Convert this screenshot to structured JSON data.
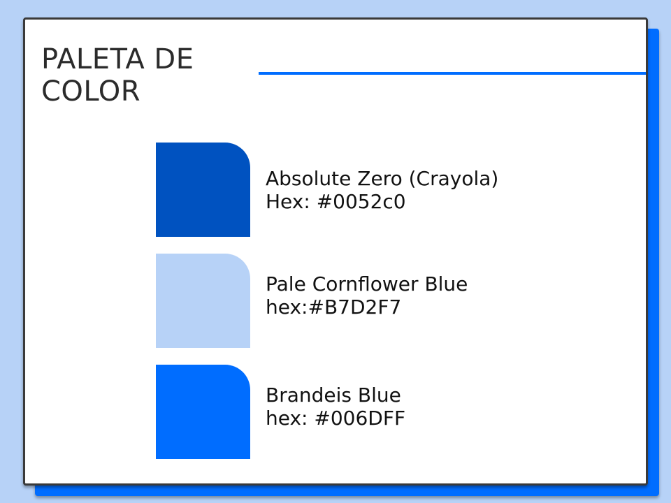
{
  "theme": {
    "background": "#B7D2F7",
    "shadow_card": "#006DFF",
    "accent_rule": "#006DFF",
    "card": "#FFFFFF",
    "title_text": "#2B2B2B"
  },
  "title": {
    "line1": "PALETA DE",
    "line2": "COLOR"
  },
  "swatches": [
    {
      "color": "#0052C0",
      "name": "Absolute Zero (Crayola)",
      "hex_label": "Hex: #0052c0"
    },
    {
      "color": "#B7D2F7",
      "name": "Pale Cornflower Blue",
      "hex_label": "hex:#B7D2F7"
    },
    {
      "color": "#006DFF",
      "name": "Brandeis Blue",
      "hex_label": "hex: #006DFF"
    }
  ]
}
